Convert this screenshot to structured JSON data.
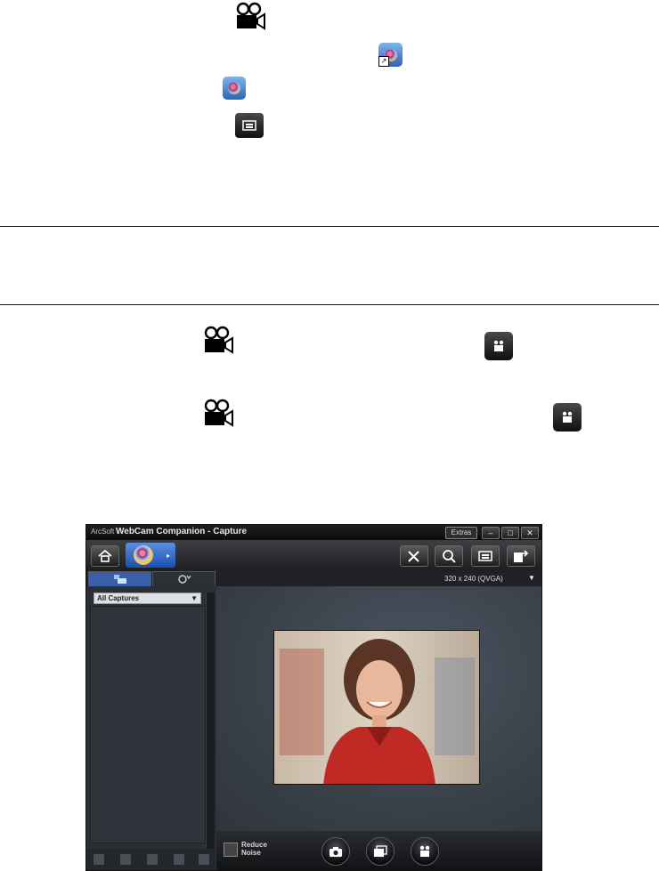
{
  "window": {
    "brand": "ArcSoft",
    "title": "WebCam Companion - Capture",
    "extras_label": "Extras",
    "minimize": "–",
    "maximize": "□",
    "close": "✕"
  },
  "resolution": "320 x 240 (QVGA)",
  "library": {
    "filter": "All Captures"
  },
  "options": {
    "reduce_noise": "Reduce\nNoise"
  },
  "icons": {
    "doc_video_icon": "video-camera-icon",
    "doc_shortcut_icon": "webcam-companion-shortcut-icon",
    "doc_app_icon": "webcam-companion-icon",
    "doc_preview_button": "preview-window-button-icon",
    "doc_record_button": "record-video-button-icon"
  },
  "colors": {
    "accent": "#2f66c6",
    "window_bg": "#2b2f36"
  }
}
